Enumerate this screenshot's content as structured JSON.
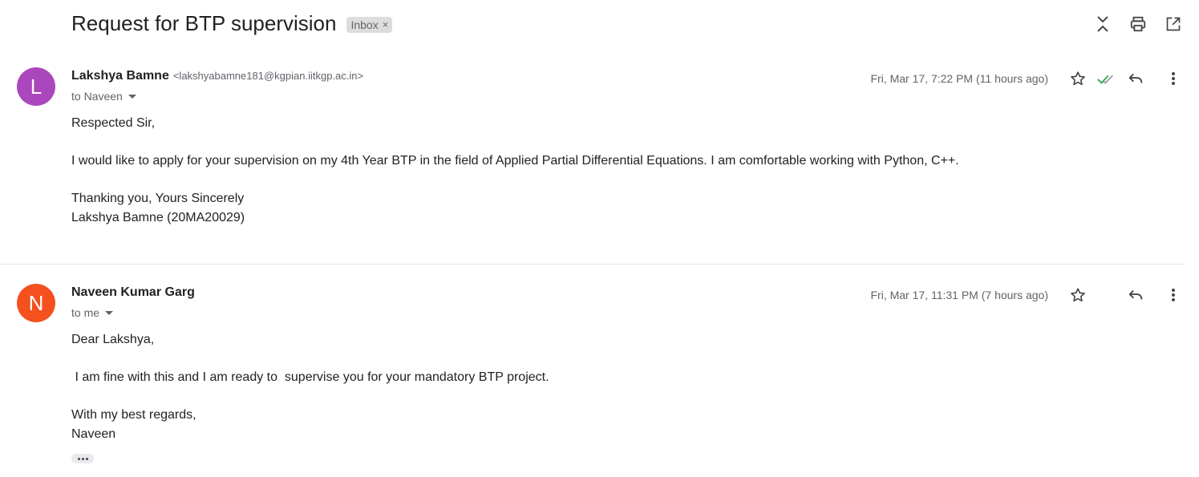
{
  "thread": {
    "subject": "Request for BTP supervision",
    "label": "Inbox",
    "label_remove": "×"
  },
  "toolbar": {
    "icons": [
      "collapse-all-icon",
      "print-icon",
      "open-in-new-window-icon"
    ]
  },
  "messages": [
    {
      "avatar_letter": "L",
      "avatar_color": "#ab47bc",
      "sender_name": "Lakshya Bamne",
      "sender_email": "<lakshyabamne181@kgpian.iitkgp.ac.in>",
      "to": "to Naveen",
      "datetime": "Fri, Mar 17, 7:22 PM (11 hours ago)",
      "icons": [
        "star-icon",
        "double-check-icon",
        "reply-icon",
        "more-vert-icon"
      ],
      "body": {
        "greeting": "Respected Sir,",
        "para1": "I would like to apply for your supervision on my 4th Year BTP in the field of Applied Partial Differential Equations. I am comfortable working with Python, C++.",
        "closing1": "Thanking you, Yours Sincerely",
        "closing2": "Lakshya Bamne (20MA20029)"
      }
    },
    {
      "avatar_letter": "N",
      "avatar_color": "#f4511e",
      "sender_name": "Naveen Kumar Garg",
      "to": "to me",
      "datetime": "Fri, Mar 17, 11:31 PM (7 hours ago)",
      "icons": [
        "star-icon",
        "reply-icon",
        "more-vert-icon"
      ],
      "body": {
        "greeting": "Dear Lakshya,",
        "para1": " I am fine with this and I am ready to  supervise you for your mandatory BTP project.",
        "closing1": "With my best regards,",
        "closing2": "Naveen"
      }
    }
  ],
  "colors": {
    "check_green": "#34a853",
    "check_gray": "#9aa0a6",
    "icon_gray": "#444746"
  }
}
